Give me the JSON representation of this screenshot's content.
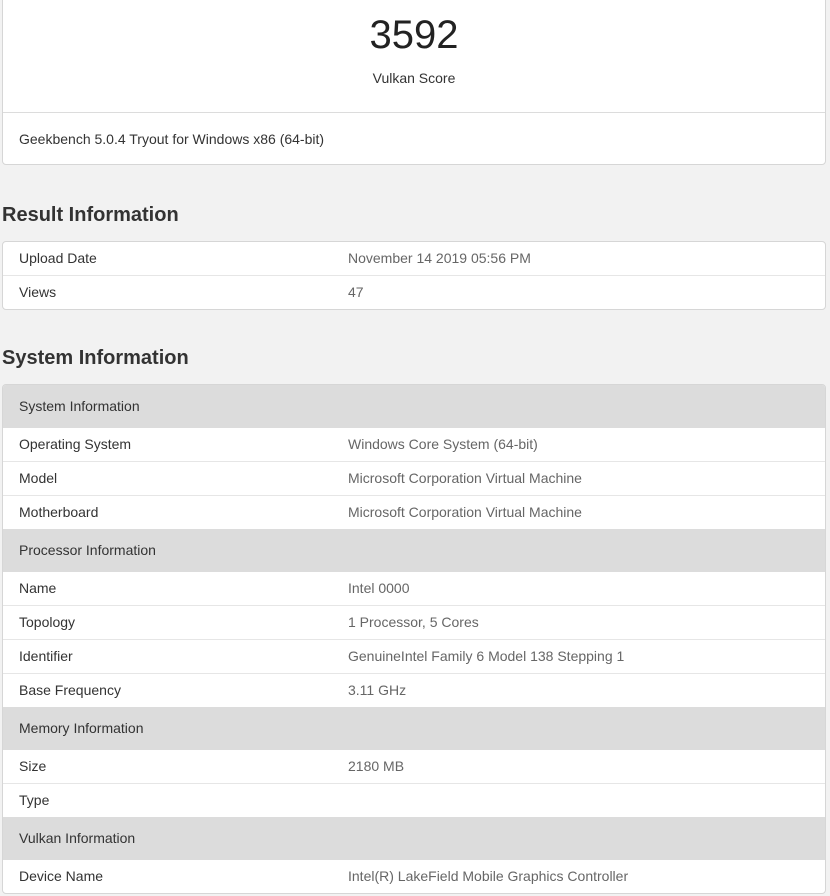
{
  "score": {
    "value": "3592",
    "label": "Vulkan Score",
    "version": "Geekbench 5.0.4 Tryout for Windows x86 (64-bit)"
  },
  "result": {
    "title": "Result Information",
    "rows": [
      {
        "key": "Upload Date",
        "value": "November 14 2019 05:56 PM"
      },
      {
        "key": "Views",
        "value": "47"
      }
    ]
  },
  "system": {
    "title": "System Information",
    "sections": [
      {
        "heading": "System Information",
        "rows": [
          {
            "key": "Operating System",
            "value": "Windows Core System (64-bit)"
          },
          {
            "key": "Model",
            "value": "Microsoft Corporation Virtual Machine"
          },
          {
            "key": "Motherboard",
            "value": "Microsoft Corporation Virtual Machine"
          }
        ]
      },
      {
        "heading": "Processor Information",
        "rows": [
          {
            "key": "Name",
            "value": "Intel 0000"
          },
          {
            "key": "Topology",
            "value": "1 Processor, 5 Cores"
          },
          {
            "key": "Identifier",
            "value": "GenuineIntel Family 6 Model 138 Stepping 1"
          },
          {
            "key": "Base Frequency",
            "value": "3.11 GHz"
          }
        ]
      },
      {
        "heading": "Memory Information",
        "rows": [
          {
            "key": "Size",
            "value": "2180 MB"
          },
          {
            "key": "Type",
            "value": ""
          }
        ]
      },
      {
        "heading": "Vulkan Information",
        "rows": [
          {
            "key": "Device Name",
            "value": "Intel(R) LakeField Mobile Graphics Controller"
          }
        ]
      }
    ]
  }
}
